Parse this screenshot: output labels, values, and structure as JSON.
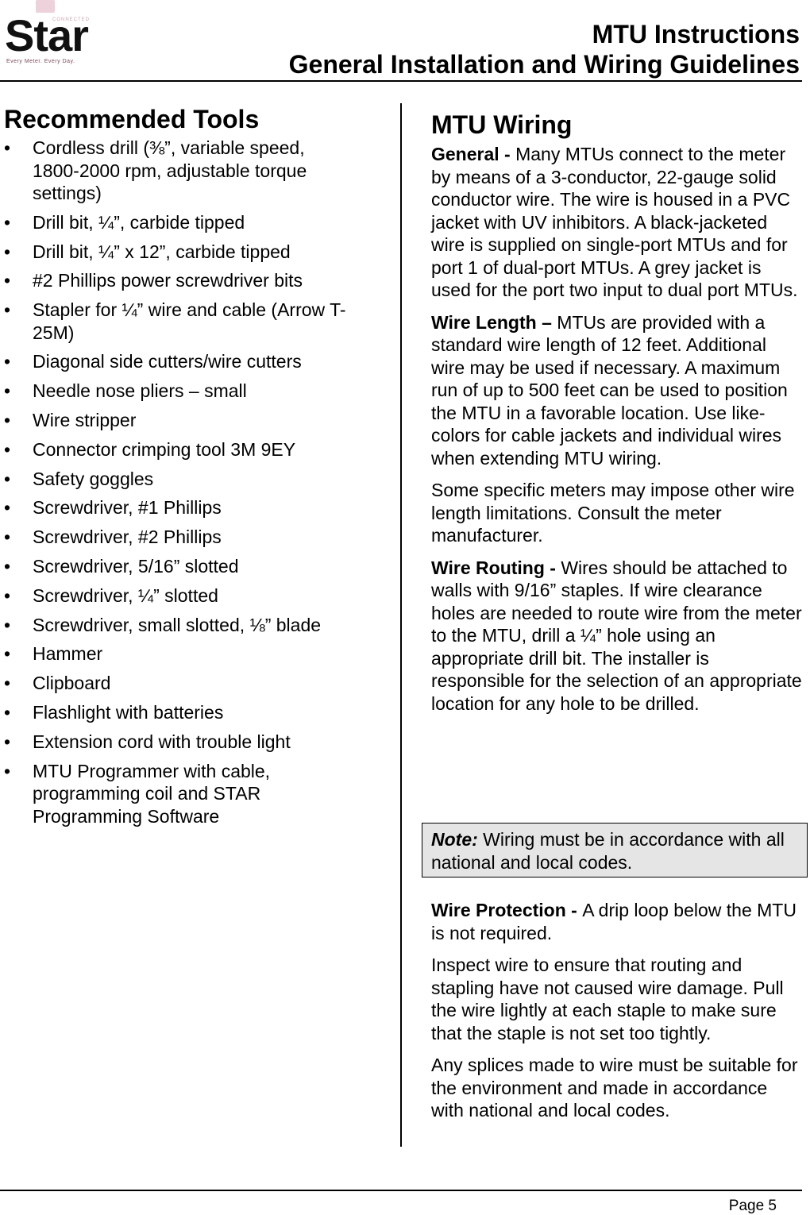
{
  "header": {
    "logo": {
      "wordmark": "Star",
      "superscript": "CONNECTED",
      "tagline": "Every Meter. Every Day."
    },
    "title_line1": "MTU Instructions",
    "title_line2": "General Installation and Wiring Guidelines"
  },
  "tools": {
    "heading": "Recommended Tools",
    "bullet_glyph": "•",
    "items": [
      "Cordless drill (⅜”, variable speed, 1800-2000 rpm, adjustable torque settings)",
      "Drill bit, ¼”, carbide tipped",
      "Drill bit, ¼” x 12”, carbide tipped",
      "#2 Phillips power screwdriver bits",
      "Stapler for ¼” wire and cable (Arrow T-25M)",
      "Diagonal side cutters/wire cutters",
      "Needle nose pliers – small",
      "Wire stripper",
      "Connector crimping tool 3M 9EY",
      "Safety goggles",
      "Screwdriver, #1 Phillips",
      "Screwdriver, #2 Phillips",
      "Screwdriver,  5/16” slotted",
      "Screwdriver, ¼” slotted",
      "Screwdriver, small slotted, ⅛” blade",
      "Hammer",
      "Clipboard",
      "Flashlight with batteries",
      "Extension cord with trouble light",
      "MTU Programmer with cable, programming coil and STAR Programming Software"
    ]
  },
  "wiring": {
    "heading": "MTU Wiring",
    "general": {
      "label": "General - ",
      "text": "Many MTUs connect to the meter by means of a 3-conductor, 22-gauge solid conductor wire.  The wire is housed in a PVC jacket with UV inhibitors.  A black-jacketed wire is supplied on single-port MTUs and for port 1 of dual-port MTUs.  A grey jacket is used for the port two input to dual port MTUs."
    },
    "length": {
      "label": "Wire Length – ",
      "text": "MTUs are provided with a standard wire length of 12 feet. Additional wire may be used if necessary.  A maximum run of up to 500 feet can be used to position the MTU in a favorable location.  Use like-colors for cable jackets and individual wires when extending MTU wiring."
    },
    "length_note": "Some specific meters may impose other wire length limitations.  Consult the meter manufacturer.",
    "routing": {
      "label": "Wire Routing - ",
      "text": "Wires should be attached to walls with 9/16” staples. If wire clearance holes are needed to route wire from the meter to the MTU, drill a ¼” hole using an appropriate drill bit. The installer is responsible for the selection of an appropriate location for any hole to be drilled."
    },
    "note": {
      "label": "Note:",
      "text": " Wiring must be in accordance with all national and local codes."
    },
    "protection": {
      "label": "Wire Protection - ",
      "text": "A drip loop below the MTU is not required."
    },
    "inspect": "Inspect wire to ensure that routing and stapling have not caused wire damage. Pull the wire lightly at each staple to make sure that the staple is not set too tightly.",
    "splices": "Any splices made to wire must be suitable for the environment and made in accordance with national and local codes."
  },
  "footer": {
    "page": "Page 5"
  }
}
